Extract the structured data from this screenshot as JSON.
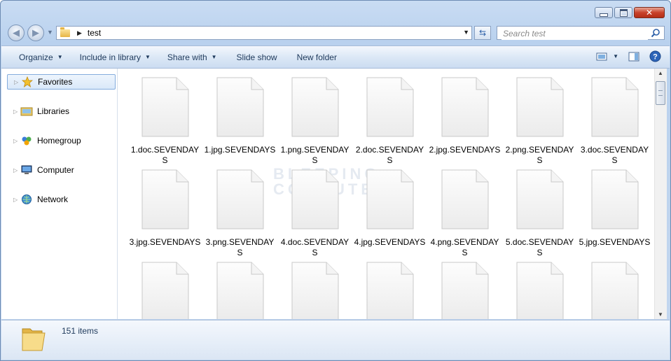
{
  "window": {
    "address_path": "test",
    "search_placeholder": "Search test"
  },
  "toolbar": {
    "organize": "Organize",
    "include_in_library": "Include in library",
    "share_with": "Share with",
    "slide_show": "Slide show",
    "new_folder": "New folder"
  },
  "sidebar": {
    "items": [
      {
        "label": "Favorites",
        "icon": "star-icon",
        "selected": true
      },
      {
        "label": "Libraries",
        "icon": "libraries-icon"
      },
      {
        "label": "Homegroup",
        "icon": "homegroup-icon"
      },
      {
        "label": "Computer",
        "icon": "computer-icon"
      },
      {
        "label": "Network",
        "icon": "network-icon"
      }
    ]
  },
  "files": [
    {
      "name": "1.doc.SEVENDAYS"
    },
    {
      "name": "1.jpg.SEVENDAYS"
    },
    {
      "name": "1.png.SEVENDAYS"
    },
    {
      "name": "2.doc.SEVENDAYS"
    },
    {
      "name": "2.jpg.SEVENDAYS"
    },
    {
      "name": "2.png.SEVENDAYS"
    },
    {
      "name": "3.doc.SEVENDAYS"
    },
    {
      "name": "3.jpg.SEVENDAYS"
    },
    {
      "name": "3.png.SEVENDAYS"
    },
    {
      "name": "4.doc.SEVENDAYS"
    },
    {
      "name": "4.jpg.SEVENDAYS"
    },
    {
      "name": "4.png.SEVENDAYS"
    },
    {
      "name": "5.doc.SEVENDAYS"
    },
    {
      "name": "5.jpg.SEVENDAYS"
    },
    {
      "name": ""
    },
    {
      "name": ""
    },
    {
      "name": ""
    },
    {
      "name": ""
    },
    {
      "name": ""
    },
    {
      "name": ""
    },
    {
      "name": ""
    }
  ],
  "watermark": {
    "line1": "BLEEPING",
    "line2": "COMPUTER"
  },
  "status": {
    "item_count": "151 items"
  },
  "colors": {
    "chrome": "#c4d7ef",
    "selection": "#d9e8f9",
    "close_button": "#c8422b"
  }
}
